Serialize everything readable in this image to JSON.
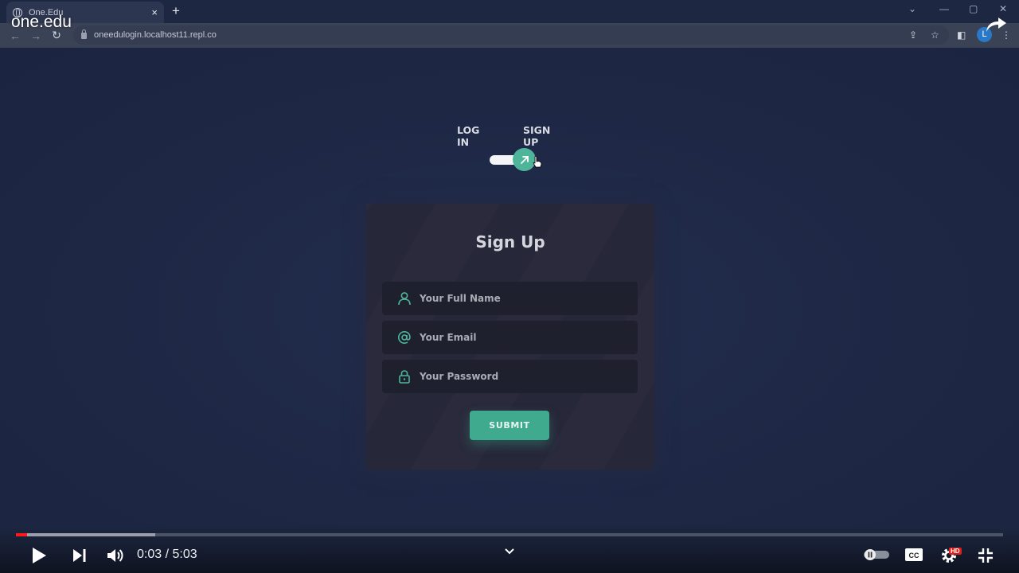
{
  "browser": {
    "tab_title": "One.Edu",
    "new_tab_symbol": "+",
    "tab_close_symbol": "×",
    "url": "oneedulogin.localhost11.repl.co",
    "profile_initial": "L",
    "watermark": "one.edu"
  },
  "auth_switch": {
    "login_label": "LOG IN",
    "signup_label": "SIGN UP",
    "state": "signup"
  },
  "signup_form": {
    "title": "Sign Up",
    "fields": [
      {
        "icon": "user-icon",
        "placeholder": "Your Full Name"
      },
      {
        "icon": "at-icon",
        "placeholder": "Your Email"
      },
      {
        "icon": "lock-icon",
        "placeholder": "Your Password"
      }
    ],
    "submit_label": "SUBMIT"
  },
  "colors": {
    "accent": "#3faa8e",
    "page_bg": "#1e2945",
    "card_bg": "#27283a",
    "progress_played": "#ff1a1a"
  },
  "player": {
    "current_time": "0:03",
    "duration": "5:03",
    "time_display": "0:03 / 5:03",
    "played_fraction": 0.011,
    "buffered_fraction": 0.141,
    "quality_badge": "HD"
  }
}
